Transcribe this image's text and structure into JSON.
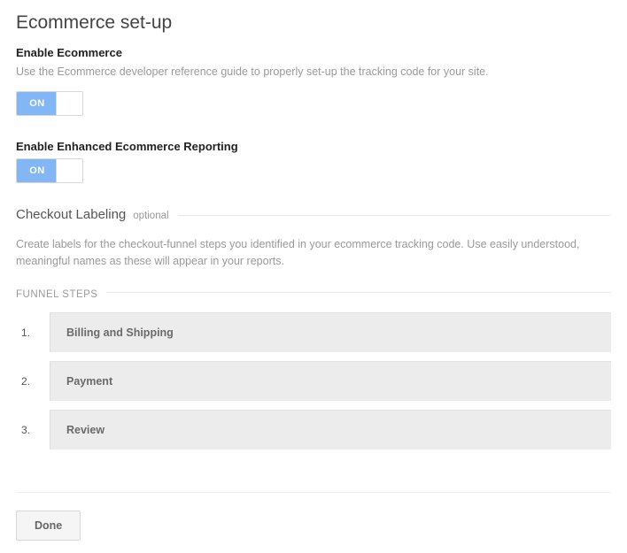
{
  "page": {
    "title": "Ecommerce set-up"
  },
  "enable_ecommerce": {
    "label": "Enable Ecommerce",
    "help": "Use the Ecommerce developer reference guide to properly set-up the tracking code for your site.",
    "toggle_label": "ON"
  },
  "enhanced_reporting": {
    "label": "Enable Enhanced Ecommerce Reporting",
    "toggle_label": "ON"
  },
  "checkout_labeling": {
    "title": "Checkout Labeling",
    "optional": "optional",
    "help": "Create labels for the checkout-funnel steps you identified in your ecommerce tracking code. Use easily understood, meaningful names as these will appear in your reports."
  },
  "funnel": {
    "header": "FUNNEL STEPS",
    "steps": [
      {
        "num": "1.",
        "label": "Billing and Shipping"
      },
      {
        "num": "2.",
        "label": "Payment"
      },
      {
        "num": "3.",
        "label": "Review"
      }
    ]
  },
  "footer": {
    "done": "Done"
  }
}
